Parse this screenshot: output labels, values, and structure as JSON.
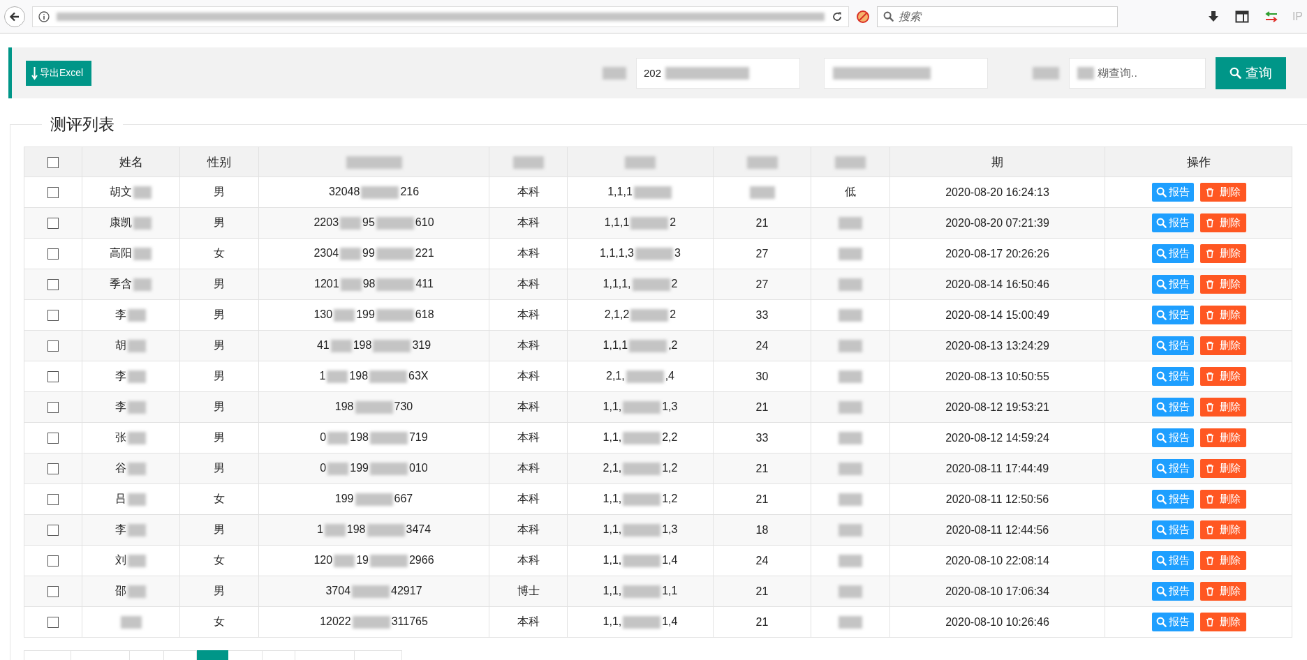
{
  "browser": {
    "search": {
      "placeholder": "搜索"
    },
    "ip_label": "IP"
  },
  "toolbar": {
    "export_button": "导出Excel",
    "date_value": "202",
    "keyword": {
      "placeholder": "糊查询.."
    },
    "search_button": "查询"
  },
  "panel": {
    "title": "测评列表"
  },
  "table": {
    "columns": [
      {
        "kind": "checkbox",
        "checked": false
      },
      {
        "kind": "text",
        "label": "姓名"
      },
      {
        "kind": "text",
        "label": "性别"
      },
      {
        "kind": "hidden"
      },
      {
        "kind": "hidden"
      },
      {
        "kind": "hidden"
      },
      {
        "kind": "hidden"
      },
      {
        "kind": "hidden"
      },
      {
        "kind": "text",
        "label": "期"
      },
      {
        "kind": "text",
        "label": "操作"
      }
    ],
    "rows": [
      {
        "checked": false,
        "name": "胡文",
        "gender": "男",
        "id_number": [
          "32048",
          "216"
        ],
        "education": "本科",
        "answers": [
          "1,1,1"
        ],
        "column_8": "低",
        "date": "2020-08-20 16:24:13",
        "actions": [
          {
            "kind": "report",
            "label": "报告"
          },
          {
            "kind": "delete",
            "label": "删除"
          }
        ]
      },
      {
        "checked": false,
        "name": "康凯",
        "gender": "男",
        "id_number": [
          "2203",
          "95",
          "610"
        ],
        "education": "本科",
        "answers": [
          "1,1,1",
          "2"
        ],
        "score": "21",
        "date": "2020-08-20 07:21:39",
        "actions": [
          {
            "kind": "report",
            "label": "报告"
          },
          {
            "kind": "delete",
            "label": "删除"
          }
        ]
      },
      {
        "checked": false,
        "name": "高阳",
        "gender": "女",
        "id_number": [
          "2304",
          "99",
          "221"
        ],
        "education": "本科",
        "answers": [
          "1,1,1,3",
          "3"
        ],
        "score": "27",
        "date": "2020-08-17 20:26:26",
        "actions": [
          {
            "kind": "report",
            "label": "报告"
          },
          {
            "kind": "delete",
            "label": "删除"
          }
        ]
      },
      {
        "checked": false,
        "name": "季含",
        "gender": "男",
        "id_number": [
          "1201",
          "98",
          "411"
        ],
        "education": "本科",
        "answers": [
          "1,1,1,",
          "2"
        ],
        "score": "27",
        "date": "2020-08-14 16:50:46",
        "actions": [
          {
            "kind": "report",
            "label": "报告"
          },
          {
            "kind": "delete",
            "label": "删除"
          }
        ]
      },
      {
        "checked": false,
        "name": "李",
        "gender": "男",
        "id_number": [
          "130",
          "199",
          "618"
        ],
        "education": "本科",
        "answers": [
          "2,1,2",
          "2"
        ],
        "score": "33",
        "date": "2020-08-14 15:00:49",
        "actions": [
          {
            "kind": "report",
            "label": "报告"
          },
          {
            "kind": "delete",
            "label": "删除"
          }
        ]
      },
      {
        "checked": false,
        "name": "胡",
        "gender": "男",
        "id_number": [
          "41",
          "198",
          "319"
        ],
        "education": "本科",
        "answers": [
          "1,1,1",
          ",2"
        ],
        "score": "24",
        "date": "2020-08-13 13:24:29",
        "actions": [
          {
            "kind": "report",
            "label": "报告"
          },
          {
            "kind": "delete",
            "label": "删除"
          }
        ]
      },
      {
        "checked": false,
        "name": "李",
        "gender": "男",
        "id_number": [
          "1",
          "198",
          "63X"
        ],
        "education": "本科",
        "answers": [
          "2,1,",
          ",4"
        ],
        "score": "30",
        "date": "2020-08-13 10:50:55",
        "actions": [
          {
            "kind": "report",
            "label": "报告"
          },
          {
            "kind": "delete",
            "label": "删除"
          }
        ]
      },
      {
        "checked": false,
        "name": "李",
        "gender": "男",
        "id_number": [
          "198",
          "730"
        ],
        "education": "本科",
        "answers": [
          "1,1,",
          "1,3"
        ],
        "score": "21",
        "date": "2020-08-12 19:53:21",
        "actions": [
          {
            "kind": "report",
            "label": "报告"
          },
          {
            "kind": "delete",
            "label": "删除"
          }
        ]
      },
      {
        "checked": false,
        "name": "张",
        "gender": "男",
        "id_number": [
          "0",
          "198",
          "719"
        ],
        "education": "本科",
        "answers": [
          "1,1,",
          "2,2"
        ],
        "score": "33",
        "date": "2020-08-12 14:59:24",
        "actions": [
          {
            "kind": "report",
            "label": "报告"
          },
          {
            "kind": "delete",
            "label": "删除"
          }
        ]
      },
      {
        "checked": false,
        "name": "谷",
        "gender": "男",
        "id_number": [
          "0",
          "199",
          "010"
        ],
        "education": "本科",
        "answers": [
          "2,1,",
          "1,2"
        ],
        "score": "21",
        "date": "2020-08-11 17:44:49",
        "actions": [
          {
            "kind": "report",
            "label": "报告"
          },
          {
            "kind": "delete",
            "label": "删除"
          }
        ]
      },
      {
        "checked": false,
        "name": "吕",
        "gender": "女",
        "id_number": [
          "199",
          "667"
        ],
        "education": "本科",
        "answers": [
          "1,1,",
          "1,2"
        ],
        "score": "21",
        "date": "2020-08-11 12:50:56",
        "actions": [
          {
            "kind": "report",
            "label": "报告"
          },
          {
            "kind": "delete",
            "label": "删除"
          }
        ]
      },
      {
        "checked": false,
        "name": "李",
        "gender": "男",
        "id_number": [
          "1",
          "198",
          "3474"
        ],
        "education": "本科",
        "answers": [
          "1,1,",
          "1,3"
        ],
        "score": "18",
        "date": "2020-08-11 12:44:56",
        "actions": [
          {
            "kind": "report",
            "label": "报告"
          },
          {
            "kind": "delete",
            "label": "删除"
          }
        ]
      },
      {
        "checked": false,
        "name": "刘",
        "gender": "女",
        "id_number": [
          "120",
          "19",
          "2966"
        ],
        "education": "本科",
        "answers": [
          "1,1,",
          "1,4"
        ],
        "score": "24",
        "date": "2020-08-10 22:08:14",
        "actions": [
          {
            "kind": "report",
            "label": "报告"
          },
          {
            "kind": "delete",
            "label": "删除"
          }
        ]
      },
      {
        "checked": false,
        "name": "邵",
        "gender": "男",
        "id_number": [
          "3704",
          "42917"
        ],
        "education": "博士",
        "answers": [
          "1,1,",
          "1,1"
        ],
        "score": "21",
        "date": "2020-08-10 17:06:34",
        "actions": [
          {
            "kind": "report",
            "label": "报告"
          },
          {
            "kind": "delete",
            "label": "删除"
          }
        ]
      },
      {
        "checked": false,
        "gender": "女",
        "id_number": [
          "12022",
          "311765"
        ],
        "education": "本科",
        "answers": [
          "1,1,",
          "1,4"
        ],
        "score": "21",
        "date": "2020-08-10 10:26:46",
        "actions": [
          {
            "kind": "report",
            "label": "报告"
          },
          {
            "kind": "delete",
            "label": "删除"
          }
        ]
      }
    ]
  },
  "pagination": [
    {
      "selected": false
    },
    {
      "selected": false
    },
    {
      "selected": false
    },
    {
      "selected": false
    },
    {
      "selected": true
    },
    {
      "selected": false
    },
    {
      "selected": false
    },
    {
      "selected": false
    },
    {
      "selected": false
    }
  ]
}
